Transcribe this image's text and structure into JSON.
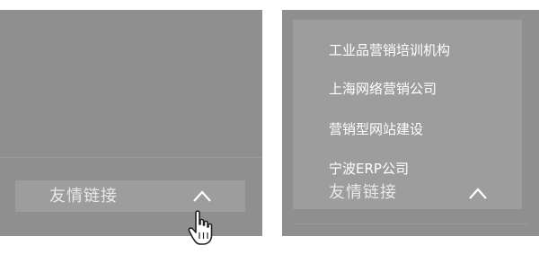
{
  "left_panel": {
    "links_label": "友情链接",
    "chevron_icon": "chevron-up-icon",
    "cursor_icon": "hand-pointer-icon"
  },
  "right_panel": {
    "links_label": "友情链接",
    "chevron_icon": "chevron-up-icon",
    "menu_items": [
      "工业品营销培训机构",
      "上海网络营销公司",
      "营销型网站建设",
      "宁波ERP公司"
    ]
  },
  "colors": {
    "panel_bg": "#8f8f8f",
    "bar_bg": "#9d9d9d",
    "text": "#e8e8e8"
  }
}
